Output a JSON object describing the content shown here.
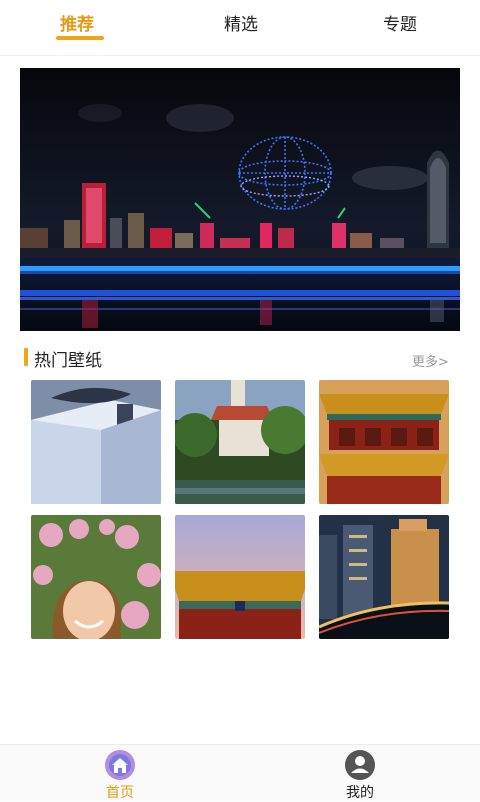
{
  "tabs": [
    {
      "label": "推荐",
      "active": true
    },
    {
      "label": "精选",
      "active": false
    },
    {
      "label": "专题",
      "active": false
    }
  ],
  "section": {
    "title": "热门壁纸",
    "more_label": "更多>"
  },
  "wallpapers": [
    {
      "subject": "gift box"
    },
    {
      "subject": "castle"
    },
    {
      "subject": "palace"
    },
    {
      "subject": "woman with flowers"
    },
    {
      "subject": "palace roof"
    },
    {
      "subject": "city night"
    }
  ],
  "bottom_nav": [
    {
      "label": "首页",
      "icon": "home-icon",
      "active": true
    },
    {
      "label": "我的",
      "icon": "user-icon",
      "active": false
    }
  ],
  "colors": {
    "accent": "#f0a51c",
    "active_text": "#e49b15"
  }
}
